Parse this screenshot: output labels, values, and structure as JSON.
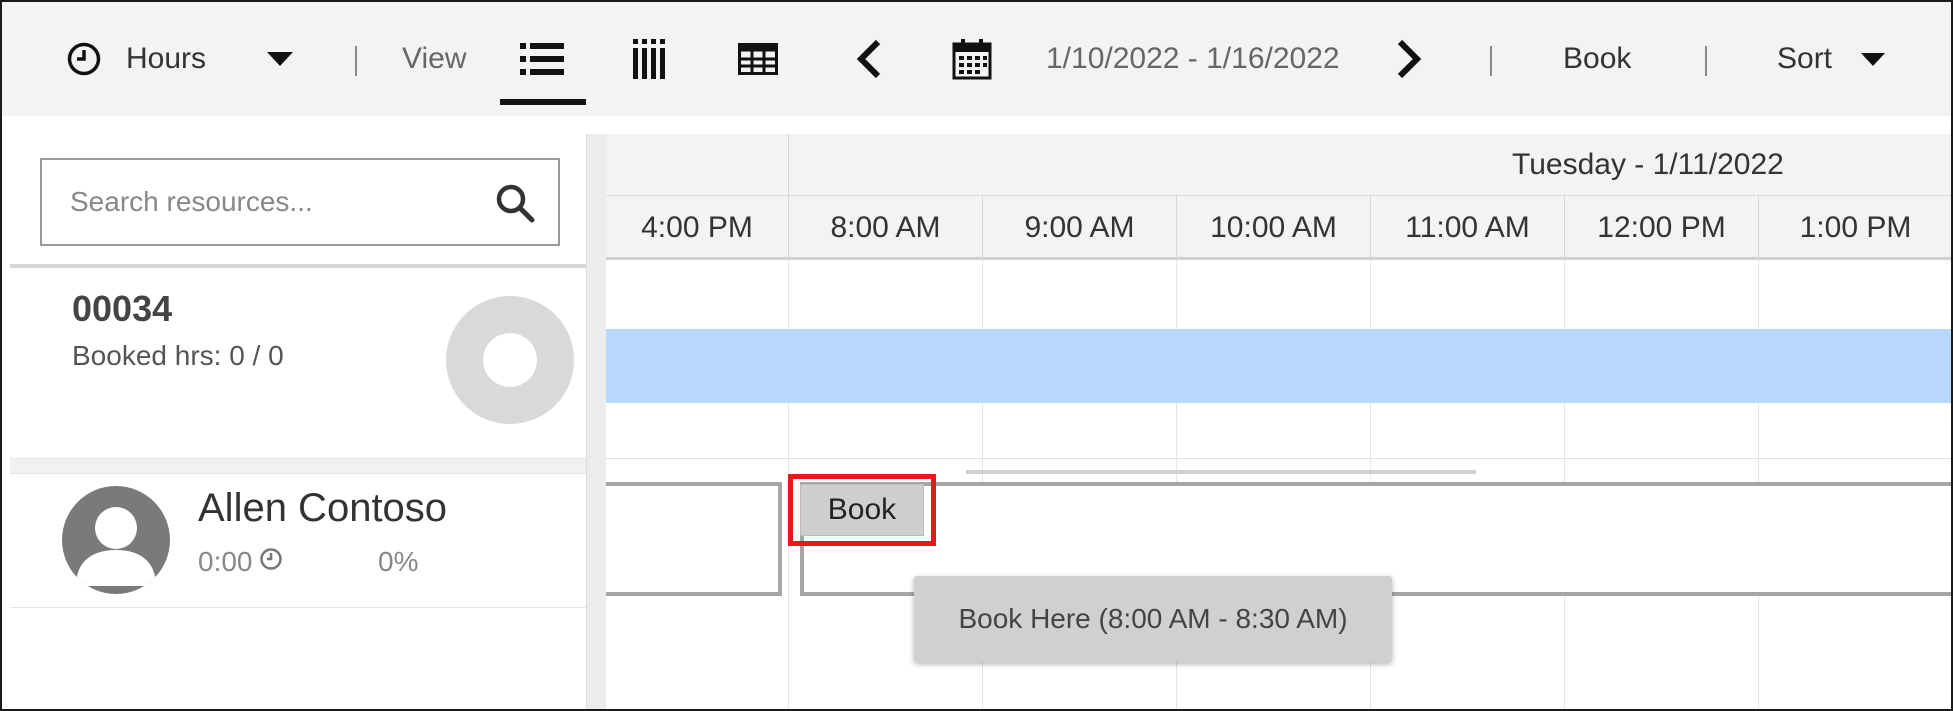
{
  "toolbar": {
    "hours_label": "Hours",
    "view_label": "View",
    "date_range": "1/10/2022 - 1/16/2022",
    "book_label": "Book",
    "sort_label": "Sort",
    "separator": "|"
  },
  "search": {
    "placeholder": "Search resources..."
  },
  "schedule": {
    "day_label": "Tuesday - 1/11/2022",
    "time_columns": [
      "4:00 PM",
      "8:00 AM",
      "9:00 AM",
      "10:00 AM",
      "11:00 AM",
      "12:00 PM",
      "1:00 PM"
    ]
  },
  "resources": [
    {
      "name": "00034",
      "booked_hours": "Booked hrs: 0 / 0"
    },
    {
      "name": "Allen Contoso",
      "time": "0:00",
      "percent": "0%"
    }
  ],
  "booking": {
    "button_label": "Book",
    "tooltip": "Book Here (8:00 AM - 8:30 AM)"
  },
  "colors": {
    "availability": "#b9d8fd",
    "highlight": "#e31b1b",
    "toolbar_bg": "#f3f3f3"
  }
}
